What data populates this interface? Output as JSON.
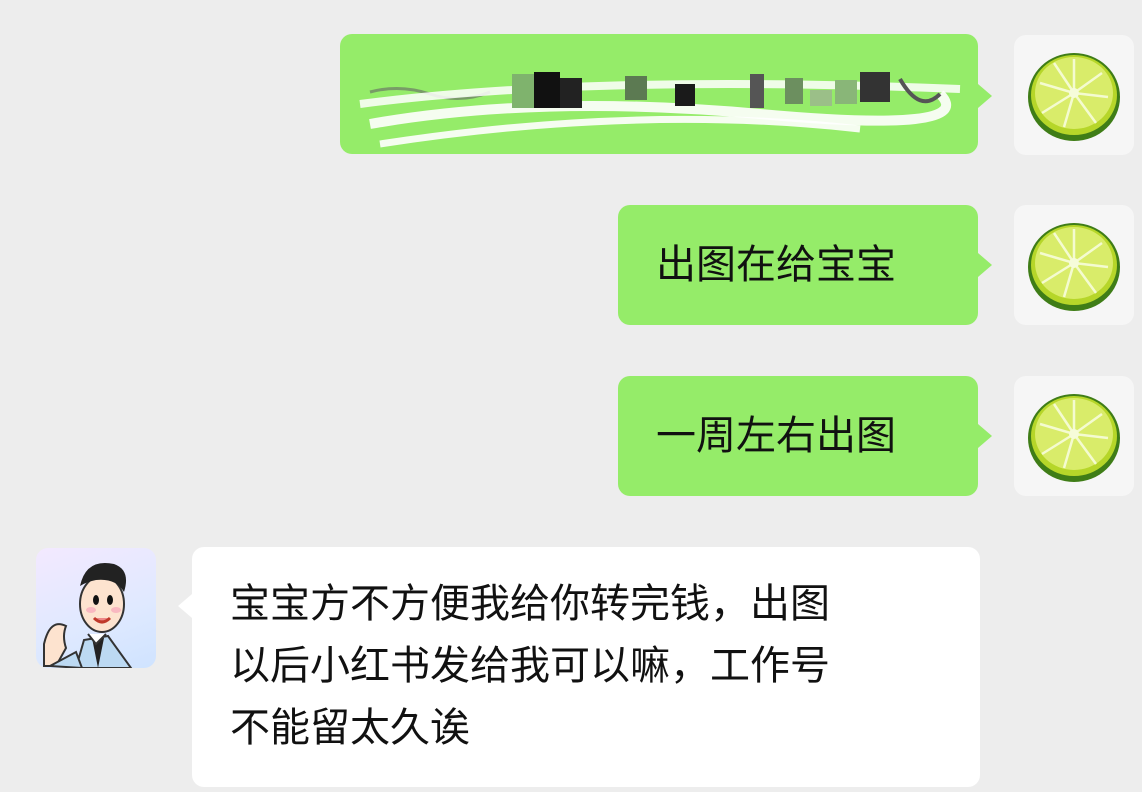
{
  "messages": [
    {
      "direction": "outgoing",
      "redacted": true,
      "text": ""
    },
    {
      "direction": "outgoing",
      "text": "出图在给宝宝"
    },
    {
      "direction": "outgoing",
      "text": "一周左右出图"
    },
    {
      "direction": "incoming",
      "lines": [
        "宝宝方不方便我给你转完钱，出图",
        "以后小红书发给我可以嘛，工作号",
        "不能留太久诶"
      ]
    }
  ],
  "colors": {
    "background": "#ededed",
    "outgoing_bubble": "#95ec69",
    "incoming_bubble": "#ffffff"
  },
  "avatars": {
    "self": "lime-slice-avatar",
    "contact": "cartoon-man-avatar"
  }
}
